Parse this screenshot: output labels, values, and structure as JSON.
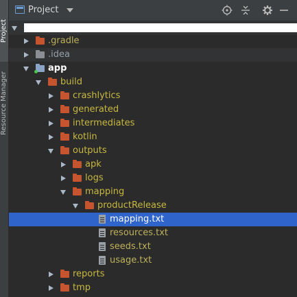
{
  "side_tabs": {
    "project": "Project",
    "resource_manager": "Resource Manager"
  },
  "header": {
    "title": "Project",
    "tools": [
      "locate-icon",
      "collapse-icon",
      "gear-icon",
      "minimize-icon"
    ]
  },
  "tree": {
    "rows": [
      {
        "label": "",
        "redacted": true
      },
      {
        "label": ".gradle"
      },
      {
        "label": ".idea"
      },
      {
        "label": "app"
      },
      {
        "label": "build"
      },
      {
        "label": "crashlytics"
      },
      {
        "label": "generated"
      },
      {
        "label": "intermediates"
      },
      {
        "label": "kotlin"
      },
      {
        "label": "outputs"
      },
      {
        "label": "apk"
      },
      {
        "label": "logs"
      },
      {
        "label": "mapping"
      },
      {
        "label": "productRelease"
      },
      {
        "label": "mapping.txt",
        "selected": true
      },
      {
        "label": "resources.txt"
      },
      {
        "label": "seeds.txt"
      },
      {
        "label": "usage.txt"
      },
      {
        "label": "reports"
      },
      {
        "label": "tmp"
      }
    ]
  }
}
